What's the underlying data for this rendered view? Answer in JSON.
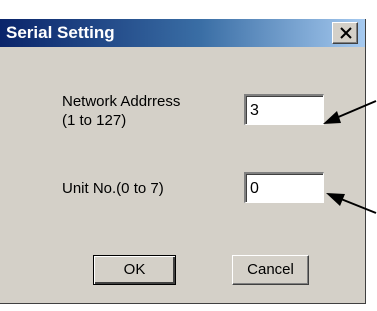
{
  "window": {
    "title": "Serial Setting",
    "close_glyph": "✕"
  },
  "form": {
    "network_address_label_line1": "Network Addrress",
    "network_address_label_line2": "(1 to 127)",
    "network_address_value": "3",
    "unit_no_label": "Unit No.(0 to 7)",
    "unit_no_value": "0"
  },
  "buttons": {
    "ok_label": "OK",
    "cancel_label": "Cancel"
  },
  "colors": {
    "title_gradient_start": "#0a246a",
    "title_gradient_end": "#a6caf0",
    "dialog_face": "#d4d0c8"
  },
  "icons": {
    "close": "close-icon",
    "annotation_arrow": "arrow-left-icon"
  }
}
